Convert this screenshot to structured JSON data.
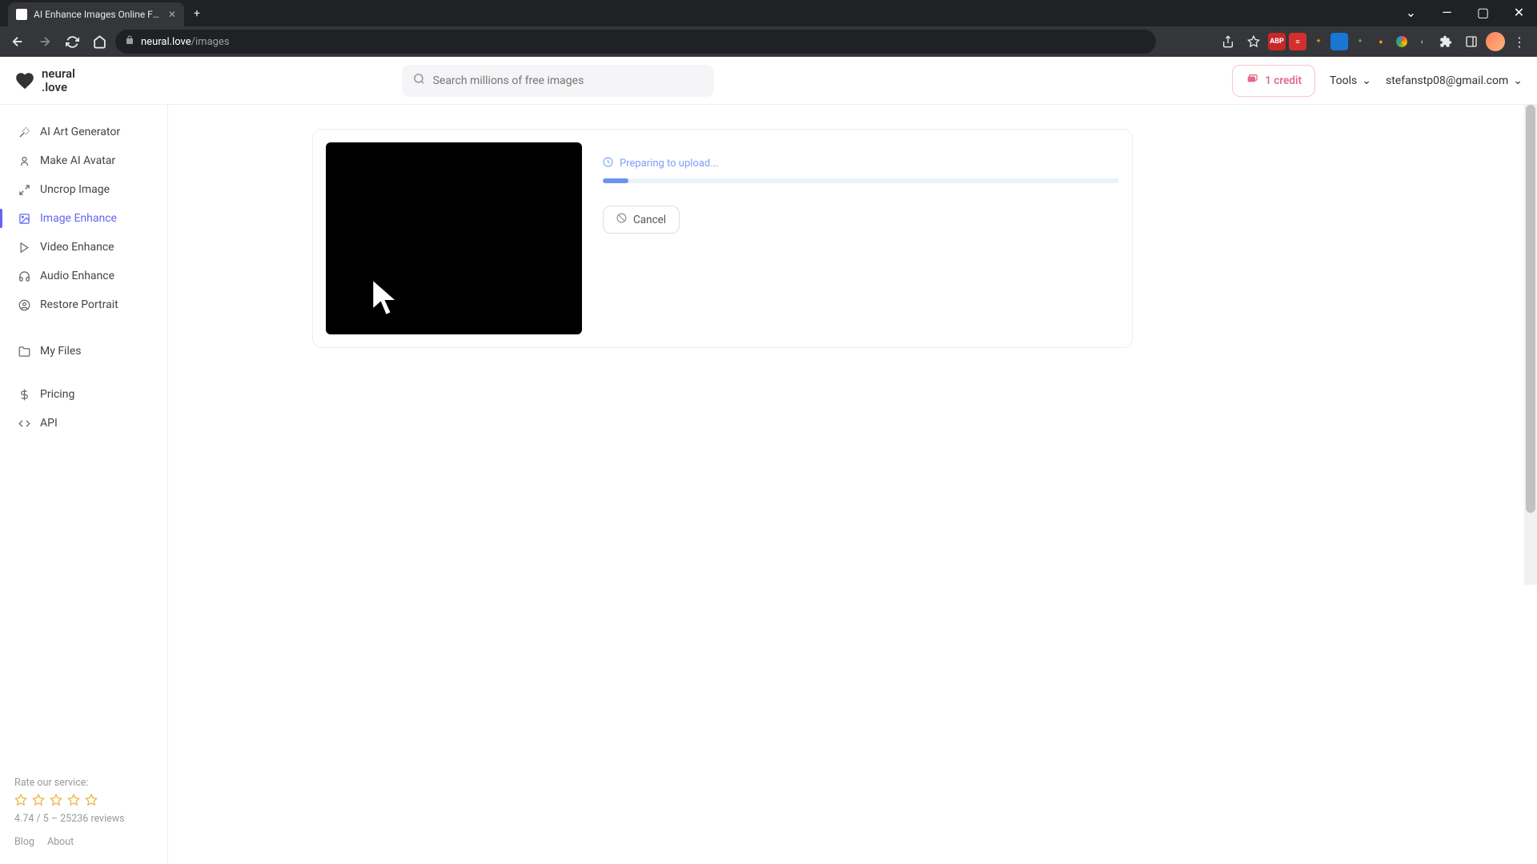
{
  "browser": {
    "tab_title": "AI Enhance Images Online For Fr",
    "url_domain": "neural.love",
    "url_path": "/images"
  },
  "header": {
    "logo_line1": "neural",
    "logo_line2": ".love",
    "search_placeholder": "Search millions of free images",
    "credit_label": "1 credit",
    "tools_label": "Tools",
    "user_email": "stefanstp08@gmail.com"
  },
  "sidebar": {
    "items": [
      {
        "label": "AI Art Generator"
      },
      {
        "label": "Make AI Avatar"
      },
      {
        "label": "Uncrop Image"
      },
      {
        "label": "Image Enhance"
      },
      {
        "label": "Video Enhance"
      },
      {
        "label": "Audio Enhance"
      },
      {
        "label": "Restore Portrait"
      }
    ],
    "my_files": "My Files",
    "pricing": "Pricing",
    "api": "API",
    "rate_label": "Rate our service:",
    "review_stats": "4.74 / 5 – 25236 reviews",
    "blog": "Blog",
    "about": "About"
  },
  "upload": {
    "status": "Preparing to upload...",
    "cancel": "Cancel",
    "progress_percent": 5
  }
}
